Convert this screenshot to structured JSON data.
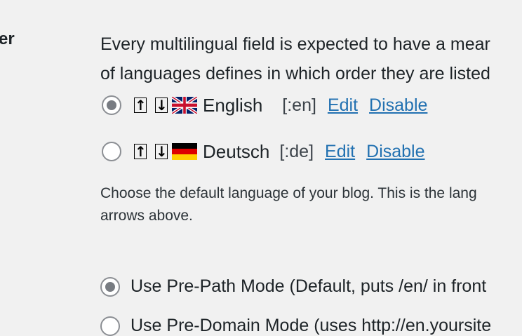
{
  "section": {
    "label": "er"
  },
  "description": {
    "line1": "Every multilingual field is expected to have a mear",
    "line2": "of languages defines in which order they are listed"
  },
  "languages": [
    {
      "name": "English",
      "code": "[:en]",
      "edit": "Edit",
      "disable": "Disable",
      "flag": "uk-flag-icon",
      "selected": true
    },
    {
      "name": "Deutsch",
      "code": "[:de]",
      "edit": "Edit",
      "disable": "Disable",
      "flag": "germany-flag-icon",
      "selected": false
    }
  ],
  "arrows": {
    "up": "↑",
    "down": "↓"
  },
  "help": {
    "line1": "Choose the default language of your blog. This is the lang",
    "line2": "arrows above."
  },
  "modes": [
    {
      "label": "Use Pre-Path Mode (Default, puts /en/ in front",
      "selected": true
    },
    {
      "label": "Use Pre-Domain Mode (uses http://en.yoursite",
      "selected": false
    }
  ],
  "colors": {
    "link": "#2271b1",
    "background": "#f1f1f1",
    "radio_dot": "#787c82"
  }
}
